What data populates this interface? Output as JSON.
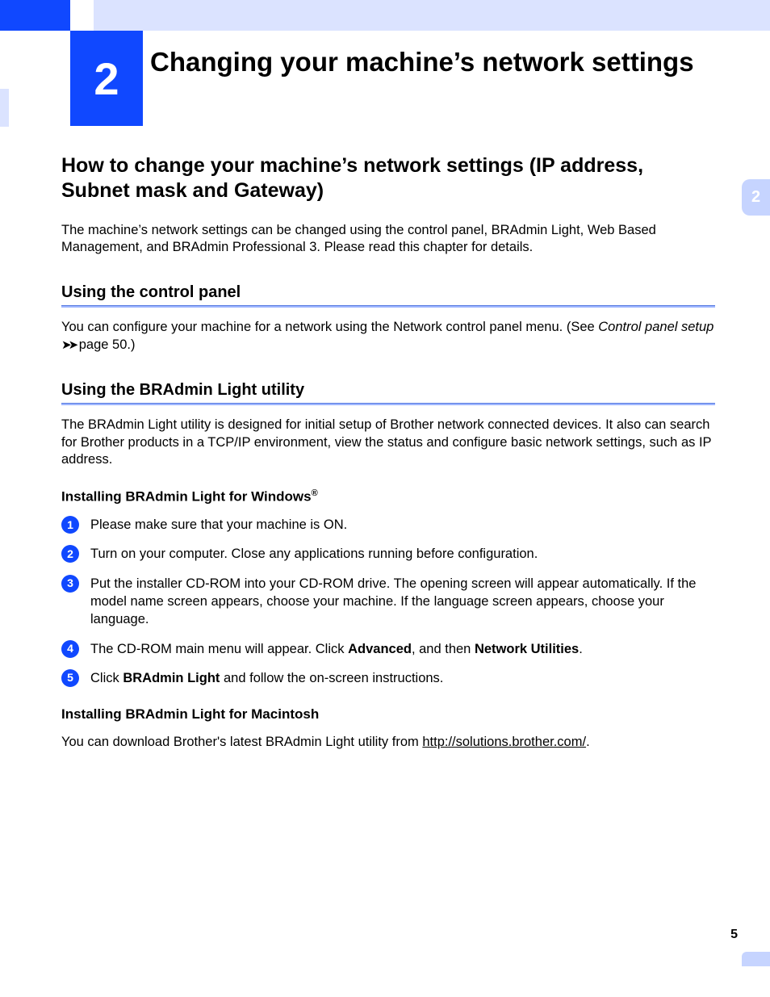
{
  "chapter": {
    "number": "2",
    "title": "Changing your machine’s network settings"
  },
  "side_tab": "2",
  "section": {
    "title": "How to change your machine’s network settings (IP address, Subnet mask and Gateway)",
    "intro": "The machine’s network settings can be changed using the control panel,  BRAdmin Light, Web Based Management, and BRAdmin Professional 3. Please read this chapter for details."
  },
  "sub_control": {
    "heading": "Using the control panel",
    "body_pre": "You can configure your machine for a network using the Network control panel menu. (See ",
    "crossref": "Control panel setup",
    "arrows": "➤➤",
    "body_post": " page 50.)"
  },
  "sub_bradmin": {
    "heading": "Using the BRAdmin Light utility",
    "body": "The BRAdmin Light utility is designed for initial setup of Brother network connected devices. It also can search for Brother products in a TCP/IP environment, view the status and configure basic network settings, such as IP address."
  },
  "install_win": {
    "heading_pre": "Installing BRAdmin Light for Windows",
    "reg": "®",
    "steps": [
      {
        "n": "1",
        "text_pre": "Please make sure that your machine is ON.",
        "bold1": "",
        "mid1": "",
        "bold2": "",
        "post": ""
      },
      {
        "n": "2",
        "text_pre": "Turn on your computer. Close any applications running before configuration.",
        "bold1": "",
        "mid1": "",
        "bold2": "",
        "post": ""
      },
      {
        "n": "3",
        "text_pre": "Put the installer CD-ROM into your CD-ROM drive. The opening screen will appear automatically. If the model name screen appears, choose your machine. If the language screen appears, choose your language.",
        "bold1": "",
        "mid1": "",
        "bold2": "",
        "post": ""
      },
      {
        "n": "4",
        "text_pre": "The CD-ROM main menu will appear. Click ",
        "bold1": "Advanced",
        "mid1": ", and then ",
        "bold2": "Network Utilities",
        "post": "."
      },
      {
        "n": "5",
        "text_pre": "Click ",
        "bold1": "BRAdmin Light",
        "mid1": " and follow the on-screen instructions.",
        "bold2": "",
        "post": ""
      }
    ]
  },
  "install_mac": {
    "heading": "Installing BRAdmin Light for Macintosh",
    "body_pre": "You can download Brother's latest BRAdmin Light utility from ",
    "link": "http://solutions.brother.com/",
    "body_post": "."
  },
  "page_number": "5"
}
